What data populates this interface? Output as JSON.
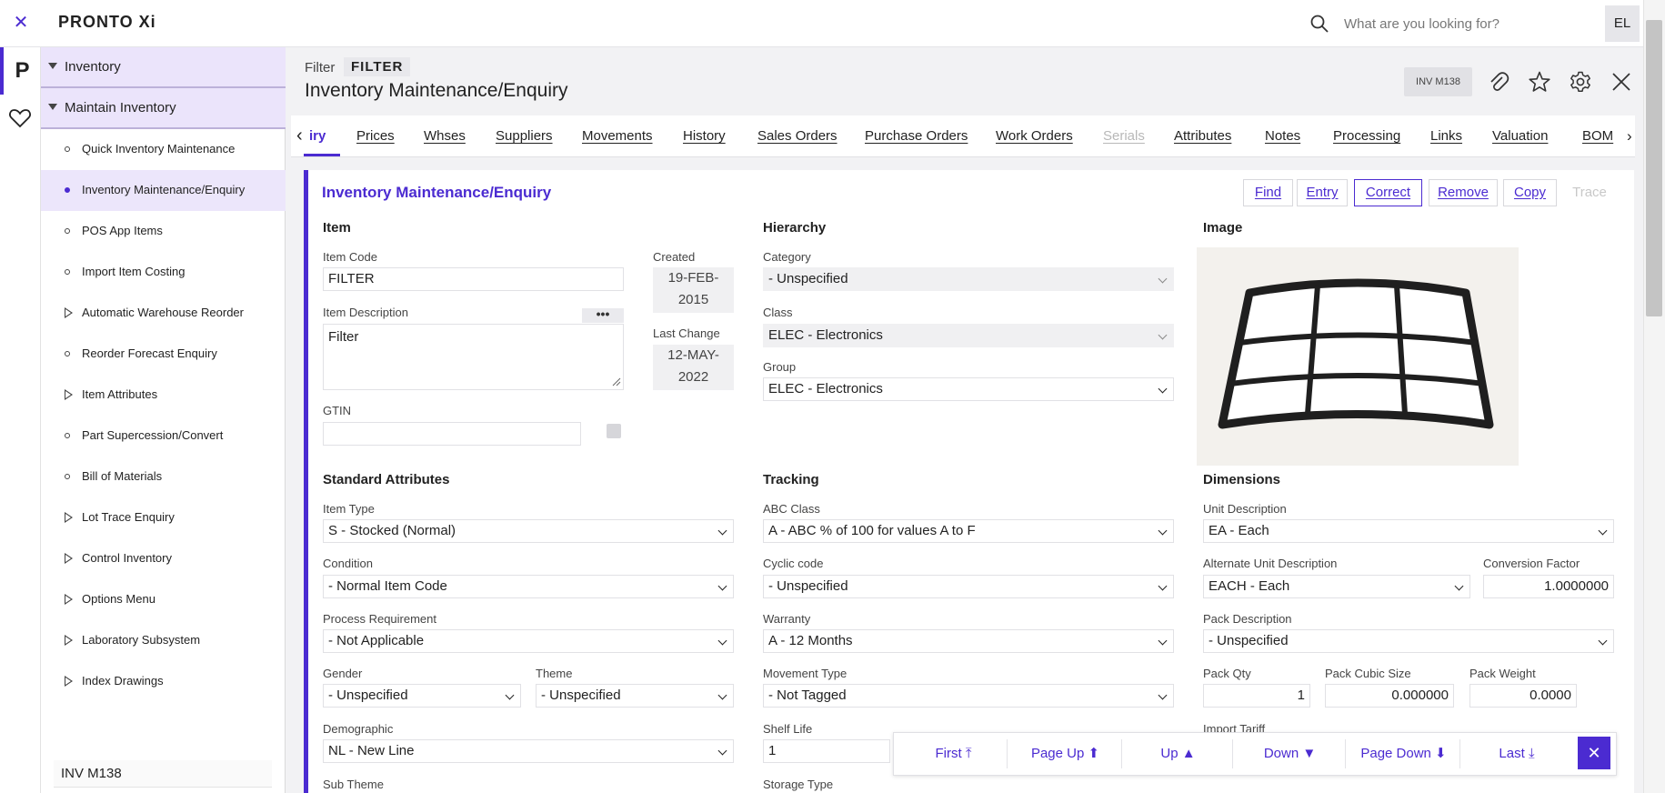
{
  "app": {
    "brand": "PRONTO Xi",
    "user_initials": "EL"
  },
  "search": {
    "placeholder": "What are you looking for?"
  },
  "nav": {
    "group1": "Inventory",
    "group2": "Maintain Inventory",
    "items": [
      {
        "label": "Quick Inventory Maintenance",
        "kind": "leaf"
      },
      {
        "label": "Inventory Maintenance/Enquiry",
        "kind": "leaf",
        "active": true
      },
      {
        "label": "POS App Items",
        "kind": "leaf"
      },
      {
        "label": "Import Item Costing",
        "kind": "leaf"
      },
      {
        "label": "Automatic Warehouse Reorder",
        "kind": "branch"
      },
      {
        "label": "Reorder Forecast Enquiry",
        "kind": "leaf"
      },
      {
        "label": "Item Attributes",
        "kind": "branch"
      },
      {
        "label": "Part Supercession/Convert",
        "kind": "leaf"
      },
      {
        "label": "Bill of Materials",
        "kind": "leaf"
      },
      {
        "label": "Lot Trace Enquiry",
        "kind": "branch"
      },
      {
        "label": "Control Inventory",
        "kind": "branch"
      },
      {
        "label": "Options Menu",
        "kind": "branch"
      },
      {
        "label": "Laboratory Subsystem",
        "kind": "branch"
      },
      {
        "label": "Index Drawings",
        "kind": "branch"
      }
    ],
    "footer": "INV M138"
  },
  "header": {
    "filter_label": "Filter",
    "filter_value": "FILTER",
    "title": "Inventory Maintenance/Enquiry",
    "badge": "INV M138"
  },
  "tabs": [
    {
      "label": "iry",
      "state": "active"
    },
    {
      "label": "Prices"
    },
    {
      "label": "Whses"
    },
    {
      "label": "Suppliers"
    },
    {
      "label": "Movements"
    },
    {
      "label": "History"
    },
    {
      "label": "Sales Orders"
    },
    {
      "label": "Purchase Orders"
    },
    {
      "label": "Work Orders"
    },
    {
      "label": "Serials",
      "state": "disabled"
    },
    {
      "label": "Attributes"
    },
    {
      "label": "Notes"
    },
    {
      "label": "Processing"
    },
    {
      "label": "Links"
    },
    {
      "label": "Valuation"
    },
    {
      "label": "BOM"
    }
  ],
  "panel": {
    "title": "Inventory Maintenance/Enquiry",
    "actions": {
      "find": "Find",
      "entry": "Entry",
      "correct": "Correct",
      "remove": "Remove",
      "copy": "Copy",
      "trace": "Trace"
    }
  },
  "item": {
    "section": "Item",
    "code_label": "Item Code",
    "code": "FILTER",
    "desc_label": "Item Description",
    "desc": "Filter",
    "desc_more": "•••",
    "gtin_label": "GTIN",
    "gtin": "",
    "created_label": "Created",
    "created_line1": "19-FEB-",
    "created_line2": "2015",
    "changed_label": "Last Change",
    "changed_line1": "12-MAY-",
    "changed_line2": "2022"
  },
  "hierarchy": {
    "section": "Hierarchy",
    "category_label": "Category",
    "category": "- Unspecified",
    "class_label": "Class",
    "class": "ELEC - Electronics",
    "group_label": "Group",
    "group": "ELEC - Electronics"
  },
  "image": {
    "section": "Image",
    "subject": "filter-frame"
  },
  "standard": {
    "section": "Standard Attributes",
    "item_type_label": "Item Type",
    "item_type": "S - Stocked (Normal)",
    "condition_label": "Condition",
    "condition": "- Normal Item Code",
    "process_label": "Process Requirement",
    "process": "- Not Applicable",
    "gender_label": "Gender",
    "gender": "- Unspecified",
    "theme_label": "Theme",
    "theme": "- Unspecified",
    "demographic_label": "Demographic",
    "demographic": "NL - New Line",
    "subtheme_label": "Sub Theme"
  },
  "tracking": {
    "section": "Tracking",
    "abc_label": "ABC Class",
    "abc": "A - ABC % of 100 for values A to F",
    "cyclic_label": "Cyclic code",
    "cyclic": "- Unspecified",
    "warranty_label": "Warranty",
    "warranty": "A - 12 Months",
    "movement_label": "Movement Type",
    "movement": "- Not Tagged",
    "shelf_label": "Shelf Life",
    "shelf": "1",
    "storage_label": "Storage Type"
  },
  "dimensions": {
    "section": "Dimensions",
    "unit_label": "Unit Description",
    "unit": "EA - Each",
    "alt_unit_label": "Alternate Unit Description",
    "alt_unit": "EACH - Each",
    "conv_label": "Conversion Factor",
    "conv": "1.0000000",
    "pack_desc_label": "Pack Description",
    "pack_desc": "- Unspecified",
    "pack_qty_label": "Pack Qty",
    "pack_qty": "1",
    "pack_cubic_label": "Pack Cubic Size",
    "pack_cubic": "0.000000",
    "pack_weight_label": "Pack Weight",
    "pack_weight": "0.0000",
    "import_label": "Import Tariff"
  },
  "pager": {
    "first": "First ⤒",
    "page_up": "Page Up ⬆",
    "up": "Up ▲",
    "down": "Down ▼",
    "page_down": "Page Down ⬇",
    "last": "Last ⤓",
    "close": "✕"
  },
  "colors": {
    "accent": "#4b2bd1",
    "nav_active": "#ece6fb"
  }
}
